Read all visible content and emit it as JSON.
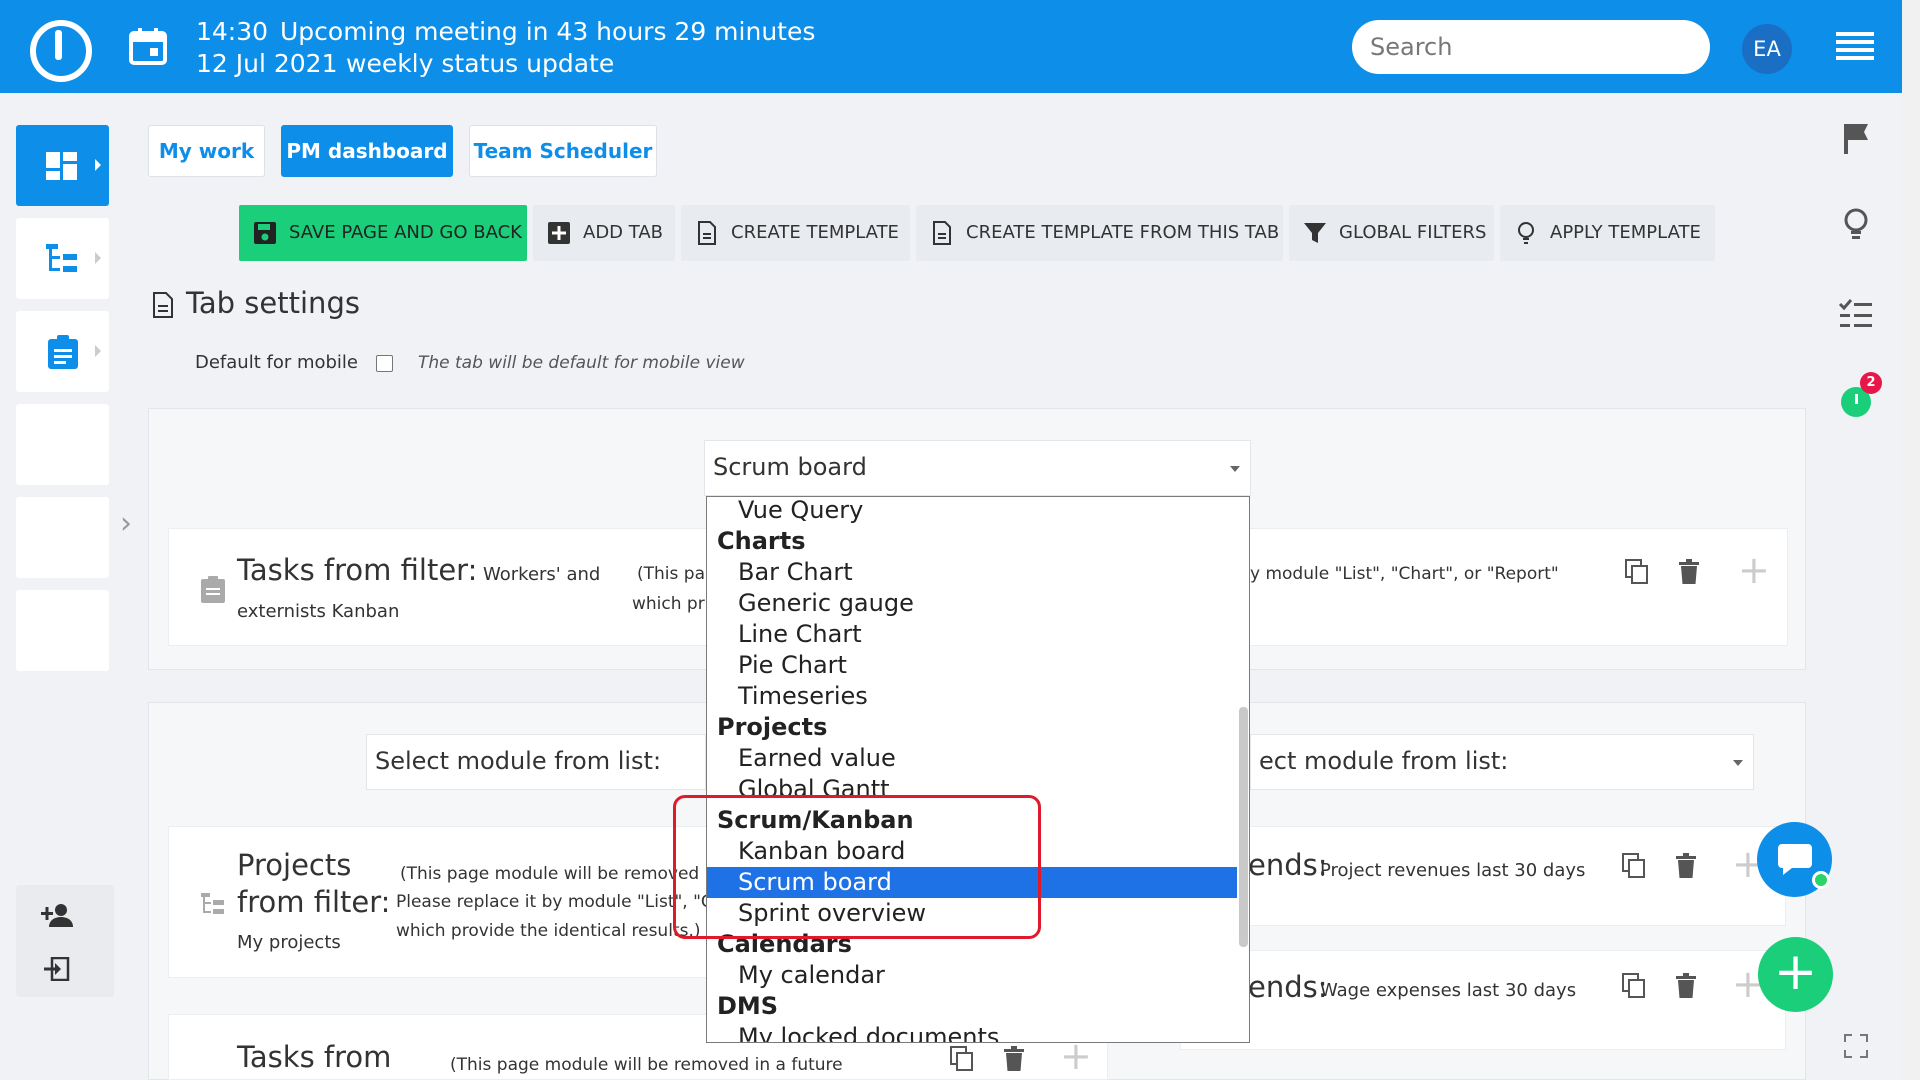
{
  "topbar": {
    "time": "14:30",
    "meeting": "Upcoming meeting in 43 hours 29 minutes",
    "date": "12 Jul 2021",
    "meeting_title": "weekly status update",
    "search_placeholder": "Search",
    "avatar_initials": "EA"
  },
  "tabs": [
    "My work",
    "PM dashboard",
    "Team Scheduler"
  ],
  "toolbar": {
    "save": "SAVE PAGE AND GO BACK",
    "add_tab": "ADD TAB",
    "create_template": "CREATE TEMPLATE",
    "create_template_tab": "CREATE TEMPLATE FROM THIS TAB",
    "global_filters": "GLOBAL FILTERS",
    "apply_template": "APPLY TEMPLATE"
  },
  "tab_settings": {
    "title": "Tab settings",
    "mobile_label": "Default for mobile",
    "mobile_hint": "The tab will be default for mobile view"
  },
  "top_select": {
    "value": "Scrum board"
  },
  "module1": {
    "title": "Tasks from filter:",
    "subtitle_a": "Workers' and",
    "subtitle_b": "externists Kanban",
    "note_a": "(This pa",
    "note_b": "which pr",
    "note_right": "y module \"List\", \"Chart\", or \"Report\""
  },
  "lower": {
    "select_left": "Select module from list:",
    "select_right": "ect module from list:"
  },
  "module2": {
    "title_a": "Projects",
    "title_b": "from filter:",
    "subtitle": "My projects",
    "note_a": "(This page module will be removed i",
    "note_b": "Please replace it by module \"List\", \"C",
    "note_c": "which provide the identical results.)"
  },
  "module3": {
    "title": "Tasks from",
    "note": "(This page module will be removed in a future"
  },
  "right_modules": {
    "r1_title": "ends:",
    "r1_sub": "Project revenues last 30 days",
    "r2_title": "ends:",
    "r2_sub": "Wage expenses last 30 days"
  },
  "dropdown": [
    {
      "type": "opt",
      "label": "Vue Query"
    },
    {
      "type": "grp",
      "label": "Charts"
    },
    {
      "type": "opt",
      "label": "Bar Chart"
    },
    {
      "type": "opt",
      "label": "Generic gauge"
    },
    {
      "type": "opt",
      "label": "Line Chart"
    },
    {
      "type": "opt",
      "label": "Pie Chart"
    },
    {
      "type": "opt",
      "label": "Timeseries"
    },
    {
      "type": "grp",
      "label": "Projects"
    },
    {
      "type": "opt",
      "label": "Earned value"
    },
    {
      "type": "opt",
      "label": "Global Gantt"
    },
    {
      "type": "grp",
      "label": "Scrum/Kanban"
    },
    {
      "type": "opt",
      "label": "Kanban board"
    },
    {
      "type": "sel",
      "label": "Scrum board"
    },
    {
      "type": "opt",
      "label": "Sprint overview"
    },
    {
      "type": "grp",
      "label": "Calendars"
    },
    {
      "type": "opt",
      "label": "My calendar"
    },
    {
      "type": "grp",
      "label": "DMS"
    },
    {
      "type": "opt",
      "label": "My locked documents"
    }
  ],
  "badge_count": "2",
  "colors": {
    "brand": "#0d8ee9",
    "save": "#1bcf7a",
    "selected": "#1e72e6",
    "highlight": "#e01a2a"
  }
}
